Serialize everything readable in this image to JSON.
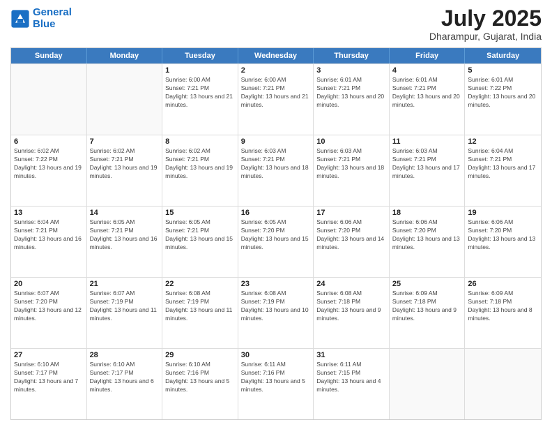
{
  "header": {
    "logo_line1": "General",
    "logo_line2": "Blue",
    "month": "July 2025",
    "location": "Dharampur, Gujarat, India"
  },
  "calendar": {
    "days_of_week": [
      "Sunday",
      "Monday",
      "Tuesday",
      "Wednesday",
      "Thursday",
      "Friday",
      "Saturday"
    ],
    "weeks": [
      [
        {
          "day": "",
          "empty": true
        },
        {
          "day": "",
          "empty": true
        },
        {
          "day": "1",
          "sunrise": "6:00 AM",
          "sunset": "7:21 PM",
          "daylight": "13 hours and 21 minutes."
        },
        {
          "day": "2",
          "sunrise": "6:00 AM",
          "sunset": "7:21 PM",
          "daylight": "13 hours and 21 minutes."
        },
        {
          "day": "3",
          "sunrise": "6:01 AM",
          "sunset": "7:21 PM",
          "daylight": "13 hours and 20 minutes."
        },
        {
          "day": "4",
          "sunrise": "6:01 AM",
          "sunset": "7:21 PM",
          "daylight": "13 hours and 20 minutes."
        },
        {
          "day": "5",
          "sunrise": "6:01 AM",
          "sunset": "7:22 PM",
          "daylight": "13 hours and 20 minutes."
        }
      ],
      [
        {
          "day": "6",
          "sunrise": "6:02 AM",
          "sunset": "7:22 PM",
          "daylight": "13 hours and 19 minutes."
        },
        {
          "day": "7",
          "sunrise": "6:02 AM",
          "sunset": "7:21 PM",
          "daylight": "13 hours and 19 minutes."
        },
        {
          "day": "8",
          "sunrise": "6:02 AM",
          "sunset": "7:21 PM",
          "daylight": "13 hours and 19 minutes."
        },
        {
          "day": "9",
          "sunrise": "6:03 AM",
          "sunset": "7:21 PM",
          "daylight": "13 hours and 18 minutes."
        },
        {
          "day": "10",
          "sunrise": "6:03 AM",
          "sunset": "7:21 PM",
          "daylight": "13 hours and 18 minutes."
        },
        {
          "day": "11",
          "sunrise": "6:03 AM",
          "sunset": "7:21 PM",
          "daylight": "13 hours and 17 minutes."
        },
        {
          "day": "12",
          "sunrise": "6:04 AM",
          "sunset": "7:21 PM",
          "daylight": "13 hours and 17 minutes."
        }
      ],
      [
        {
          "day": "13",
          "sunrise": "6:04 AM",
          "sunset": "7:21 PM",
          "daylight": "13 hours and 16 minutes."
        },
        {
          "day": "14",
          "sunrise": "6:05 AM",
          "sunset": "7:21 PM",
          "daylight": "13 hours and 16 minutes."
        },
        {
          "day": "15",
          "sunrise": "6:05 AM",
          "sunset": "7:21 PM",
          "daylight": "13 hours and 15 minutes."
        },
        {
          "day": "16",
          "sunrise": "6:05 AM",
          "sunset": "7:20 PM",
          "daylight": "13 hours and 15 minutes."
        },
        {
          "day": "17",
          "sunrise": "6:06 AM",
          "sunset": "7:20 PM",
          "daylight": "13 hours and 14 minutes."
        },
        {
          "day": "18",
          "sunrise": "6:06 AM",
          "sunset": "7:20 PM",
          "daylight": "13 hours and 13 minutes."
        },
        {
          "day": "19",
          "sunrise": "6:06 AM",
          "sunset": "7:20 PM",
          "daylight": "13 hours and 13 minutes."
        }
      ],
      [
        {
          "day": "20",
          "sunrise": "6:07 AM",
          "sunset": "7:20 PM",
          "daylight": "13 hours and 12 minutes."
        },
        {
          "day": "21",
          "sunrise": "6:07 AM",
          "sunset": "7:19 PM",
          "daylight": "13 hours and 11 minutes."
        },
        {
          "day": "22",
          "sunrise": "6:08 AM",
          "sunset": "7:19 PM",
          "daylight": "13 hours and 11 minutes."
        },
        {
          "day": "23",
          "sunrise": "6:08 AM",
          "sunset": "7:19 PM",
          "daylight": "13 hours and 10 minutes."
        },
        {
          "day": "24",
          "sunrise": "6:08 AM",
          "sunset": "7:18 PM",
          "daylight": "13 hours and 9 minutes."
        },
        {
          "day": "25",
          "sunrise": "6:09 AM",
          "sunset": "7:18 PM",
          "daylight": "13 hours and 9 minutes."
        },
        {
          "day": "26",
          "sunrise": "6:09 AM",
          "sunset": "7:18 PM",
          "daylight": "13 hours and 8 minutes."
        }
      ],
      [
        {
          "day": "27",
          "sunrise": "6:10 AM",
          "sunset": "7:17 PM",
          "daylight": "13 hours and 7 minutes."
        },
        {
          "day": "28",
          "sunrise": "6:10 AM",
          "sunset": "7:17 PM",
          "daylight": "13 hours and 6 minutes."
        },
        {
          "day": "29",
          "sunrise": "6:10 AM",
          "sunset": "7:16 PM",
          "daylight": "13 hours and 5 minutes."
        },
        {
          "day": "30",
          "sunrise": "6:11 AM",
          "sunset": "7:16 PM",
          "daylight": "13 hours and 5 minutes."
        },
        {
          "day": "31",
          "sunrise": "6:11 AM",
          "sunset": "7:15 PM",
          "daylight": "13 hours and 4 minutes."
        },
        {
          "day": "",
          "empty": true
        },
        {
          "day": "",
          "empty": true
        }
      ]
    ]
  }
}
